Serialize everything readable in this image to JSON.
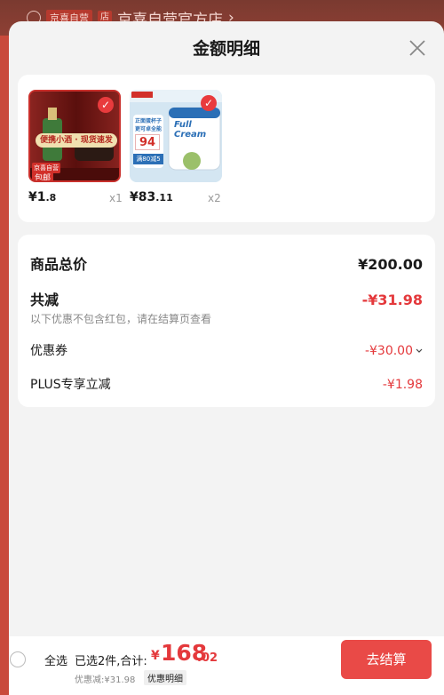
{
  "background": {
    "badge": "京喜自营",
    "shop_icon": "店",
    "shop_name": "京喜自营官方店",
    "chevron": "›"
  },
  "sheet": {
    "title": "金额明细"
  },
  "products": [
    {
      "price_symbol": "¥",
      "price_int": "1",
      "price_dec": ".8",
      "qty": "x1",
      "promo_text": "便携小酒 · 现货速发",
      "tag_top": "京喜自营",
      "tag_bottom": "包邮"
    },
    {
      "price_symbol": "¥",
      "price_int": "83",
      "price_dec": ".11",
      "qty": "x2",
      "brand_text": "Full Cream",
      "promo_number": "94",
      "promo_badge": "满80减5"
    }
  ],
  "summary": {
    "total_label": "商品总价",
    "total_value": "¥200.00",
    "reduce_label": "共减",
    "reduce_value": "-¥31.98",
    "note": "以下优惠不包含红包，请在结算页查看",
    "coupon_label": "优惠券",
    "coupon_value": "-¥30.00",
    "plus_label": "PLUS专享立减",
    "plus_value": "-¥1.98"
  },
  "footer": {
    "select_all": "全选",
    "selected_info": "已选2件,合计:",
    "total_symbol": "¥",
    "total_int": "168",
    "total_dec": ".02",
    "discount_text": "优惠减:¥31.98",
    "detail_tag": "优惠明细",
    "checkout_label": "去结算"
  },
  "colors": {
    "accent_red": "#e4393c",
    "checkout_bg": "#e94a47"
  }
}
